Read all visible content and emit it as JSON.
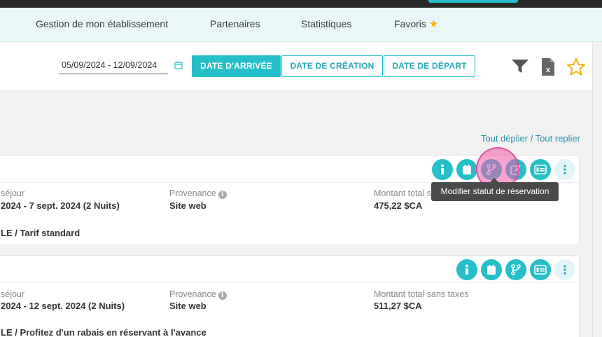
{
  "nav": {
    "items": [
      {
        "label": "Gestion de mon établissement"
      },
      {
        "label": "Partenaires"
      },
      {
        "label": "Statistiques"
      },
      {
        "label": "Favoris"
      }
    ]
  },
  "filters": {
    "date_range": "05/09/2024 - 12/09/2024",
    "buttons": [
      {
        "label": "DATE D'ARRIVÉE",
        "active": true
      },
      {
        "label": "DATE DE CRÉATION",
        "active": false
      },
      {
        "label": "DATE DE DÉPART",
        "active": false
      }
    ],
    "tools": [
      "filter-icon",
      "excel-export-icon",
      "favorite-star-icon"
    ]
  },
  "links": {
    "expand_all": "Tout déplier",
    "separator": " / ",
    "collapse_all": "Tout replier"
  },
  "reservations": [
    {
      "stay_label": "séjour",
      "stay_value": "2024 - 7 sept. 2024 (2 Nuits)",
      "source_label": "Provenance",
      "source_value": "Site web",
      "amount_label": "Montant total s",
      "amount_value": "475,22 $CA",
      "room_rate": "LE / Tarif standard",
      "actions": [
        "info-icon",
        "calendar-icon",
        "status-branch-icon",
        "edit-icon",
        "payment-card-icon",
        "more-vertical-icon"
      ]
    },
    {
      "stay_label": "séjour",
      "stay_value": " 2024 - 12 sept. 2024 (2 Nuits)",
      "source_label": "Provenance",
      "source_value": "Site web",
      "amount_label": "Montant total sans taxes",
      "amount_value": "511,27 $CA",
      "room_rate": "LE / Profitez d'un rabais en réservant à l'avance",
      "actions": [
        "info-icon",
        "calendar-icon",
        "status-branch-icon",
        "payment-card-icon",
        "more-vertical-icon"
      ]
    }
  ],
  "tooltip": {
    "text": "Modifier statut de réservation"
  },
  "colors": {
    "accent": "#26bfc9",
    "nav_bg": "#e9f7f9",
    "star": "#f4b400",
    "tooltip_bg": "#4a4a4a",
    "cursor_highlight": "#f05aaa"
  }
}
